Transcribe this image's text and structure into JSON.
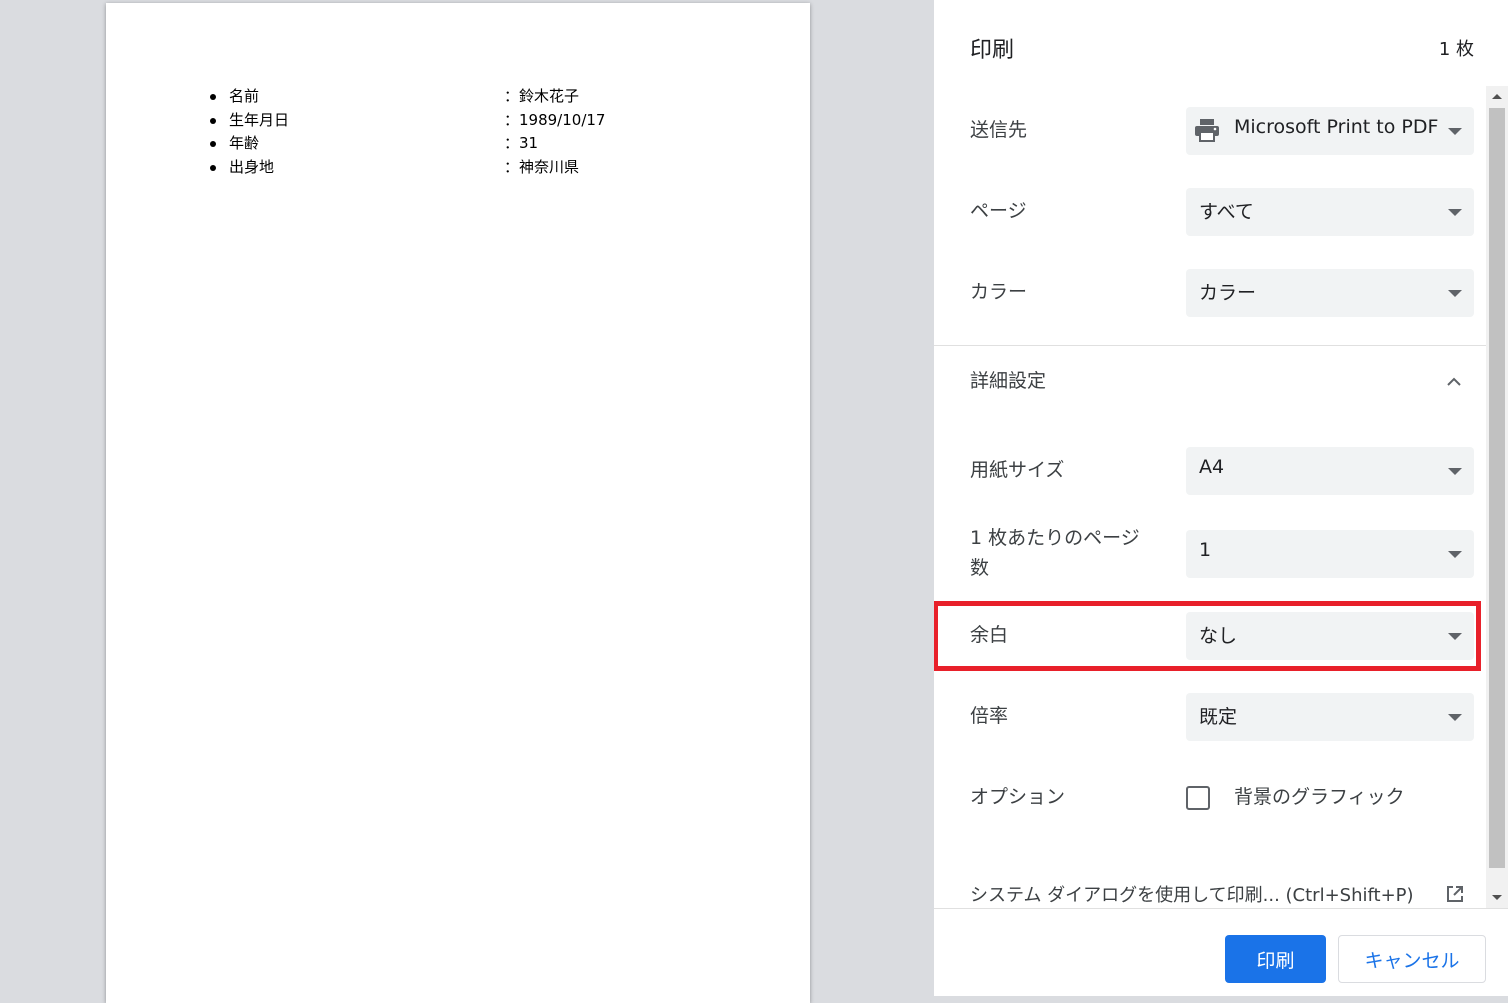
{
  "document": {
    "items": [
      {
        "label": "名前",
        "value": "：鈴木花子"
      },
      {
        "label": "生年月日",
        "value": "：1989/10/17"
      },
      {
        "label": "年齢",
        "value": "：31"
      },
      {
        "label": "出身地",
        "value": "：神奈川県"
      }
    ]
  },
  "sidebar": {
    "title": "印刷",
    "sheet_count": "1 枚",
    "destination": {
      "label": "送信先",
      "value": "Microsoft Print to PDF",
      "icon": "printer-icon"
    },
    "pages": {
      "label": "ページ",
      "value": "すべて"
    },
    "color": {
      "label": "カラー",
      "value": "カラー"
    },
    "advanced": {
      "label": "詳細設定",
      "icon": "chevron-up-icon"
    },
    "paper_size": {
      "label": "用紙サイズ",
      "value": "A4"
    },
    "pages_per_sheet": {
      "label_line1": "1 枚あたりのページ",
      "label_line2": "数",
      "value": "1"
    },
    "margins": {
      "label": "余白",
      "value": "なし"
    },
    "scale": {
      "label": "倍率",
      "value": "既定"
    },
    "options": {
      "label": "オプション",
      "checkbox_label": "背景のグラフィック",
      "checked": false
    },
    "system_dialog": {
      "label": "システム ダイアログを使用して印刷... (Ctrl+Shift+P)",
      "icon": "open-in-new-icon"
    }
  },
  "footer": {
    "print_label": "印刷",
    "cancel_label": "キャンセル"
  },
  "colors": {
    "accent": "#1a73e8",
    "highlight": "#e8202a",
    "select_bg": "#f1f3f4"
  }
}
